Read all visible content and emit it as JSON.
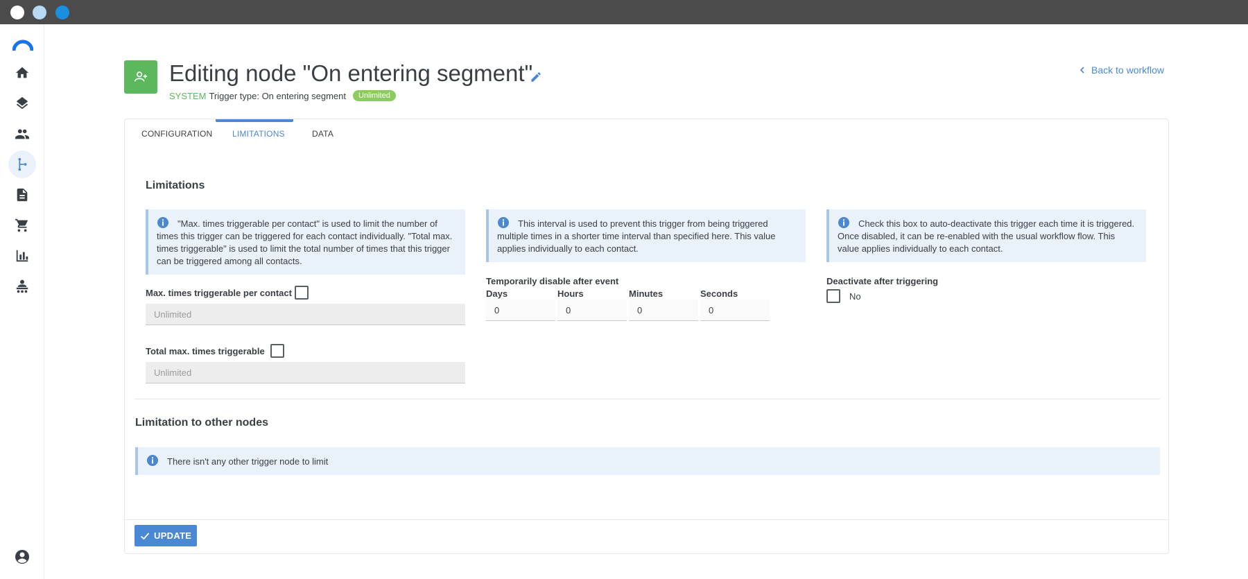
{
  "window": {
    "dots": [
      "#ffffff",
      "#b7daf2",
      "#1a8fe0"
    ]
  },
  "sidebar": {
    "items": [
      {
        "name": "home",
        "icon": "home-icon",
        "active": false
      },
      {
        "name": "layers",
        "icon": "layers-icon",
        "active": false
      },
      {
        "name": "contacts",
        "icon": "people-icon",
        "active": false
      },
      {
        "name": "workflows",
        "icon": "workflow-icon",
        "active": true
      },
      {
        "name": "documents",
        "icon": "document-icon",
        "active": false
      },
      {
        "name": "cart",
        "icon": "cart-icon",
        "active": false
      },
      {
        "name": "reports",
        "icon": "bar-chart-icon",
        "active": false
      },
      {
        "name": "admin",
        "icon": "admin-icon",
        "active": false
      }
    ],
    "bottom_icon": "account-icon"
  },
  "header": {
    "title": "Editing node \"On entering segment\"",
    "system_label": "SYSTEM",
    "trigger_type": "Trigger type: On entering segment",
    "badge": "Unlimited",
    "back_label": "Back to workflow",
    "accent": "#5cb85c"
  },
  "tabs": [
    {
      "label": "CONFIGURATION",
      "active": false
    },
    {
      "label": "LIMITATIONS",
      "active": true
    },
    {
      "label": "DATA",
      "active": false
    }
  ],
  "limitations": {
    "title": "Limitations",
    "info_1": "\"Max. times triggerable per contact\" is used to limit the number of times this trigger can be triggered for each contact individually. \"Total max. times triggerable\" is used to limit the total number of times that this trigger can be triggered among all contacts.",
    "info_2": "This interval is used to prevent this trigger from being triggered multiple times in a shorter time interval than specified here. This value applies individually to each contact.",
    "info_3": "Check this box to auto-deactivate this trigger each time it is triggered. Once disabled, it can be re-enabled with the usual workflow flow. This value applies individually to each contact.",
    "max_per_contact": {
      "label": "Max. times triggerable per contact",
      "checked": false,
      "placeholder": "Unlimited"
    },
    "total_max": {
      "label": "Total max. times triggerable",
      "checked": false,
      "placeholder": "Unlimited"
    },
    "temp_disable": {
      "label": "Temporarily disable after event",
      "fields": [
        {
          "label": "Days",
          "value": "0"
        },
        {
          "label": "Hours",
          "value": "0"
        },
        {
          "label": "Minutes",
          "value": "0"
        },
        {
          "label": "Seconds",
          "value": "0"
        }
      ]
    },
    "deactivate": {
      "label": "Deactivate after triggering",
      "checked": false,
      "value_label": "No"
    }
  },
  "other_nodes": {
    "title": "Limitation to other nodes",
    "info": "There isn't any other trigger node to limit"
  },
  "footer": {
    "update_label": "UPDATE"
  },
  "colors": {
    "primary": "#4a88d4",
    "info_bg": "#e9f1fb",
    "success": "#5cb85c"
  }
}
